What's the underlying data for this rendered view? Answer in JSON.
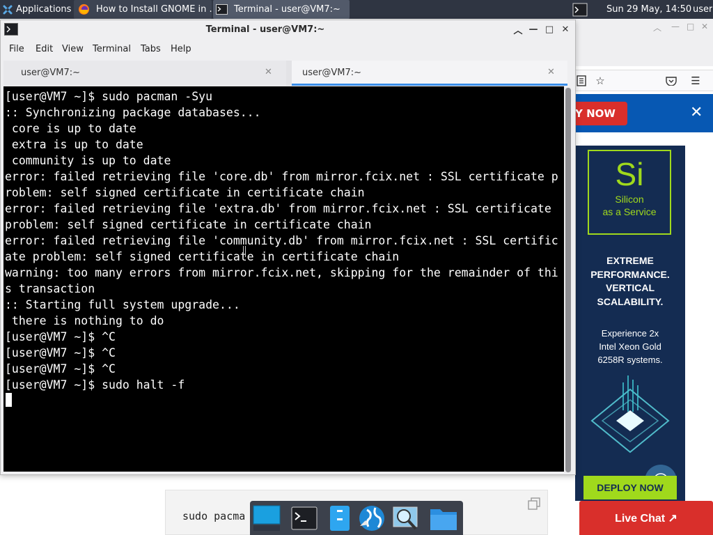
{
  "top_panel": {
    "applications_label": "Applications",
    "tasks": [
      {
        "label": "How to Install GNOME in ...",
        "icon": "firefox-icon"
      },
      {
        "label": "Terminal - user@VM7:~",
        "icon": "terminal-icon"
      }
    ],
    "clock": "Sun 29 May, 14:50",
    "user": "user"
  },
  "browser": {
    "banner_button": "Y NOW",
    "ad": {
      "logo_big": "Si",
      "logo_line1": "Silicon",
      "logo_line2": "as a Service",
      "headline": [
        "EXTREME",
        "PERFORMANCE.",
        "VERTICAL",
        "SCALABILITY."
      ],
      "copy": [
        "Experience 2x",
        "Intel Xeon Gold",
        "6258R systems."
      ],
      "cta": "DEPLOY NOW"
    },
    "live_chat": "Live Chat ↗",
    "code_snippet": "sudo pacma"
  },
  "terminal": {
    "title": "Terminal - user@VM7:~",
    "menu": [
      "File",
      "Edit",
      "View",
      "Terminal",
      "Tabs",
      "Help"
    ],
    "tabs": [
      {
        "label": "user@VM7:~",
        "active": false
      },
      {
        "label": "user@VM7:~",
        "active": true
      }
    ],
    "lines": [
      "[user@VM7 ~]$ sudo pacman -Syu",
      ":: Synchronizing package databases...",
      " core is up to date",
      " extra is up to date",
      " community is up to date",
      "error: failed retrieving file 'core.db' from mirror.fcix.net : SSL certificate p",
      "roblem: self signed certificate in certificate chain",
      "error: failed retrieving file 'extra.db' from mirror.fcix.net : SSL certificate",
      "problem: self signed certificate in certificate chain",
      "error: failed retrieving file 'community.db' from mirror.fcix.net : SSL certific",
      "ate problem: self signed certificate in certificate chain",
      "warning: too many errors from mirror.fcix.net, skipping for the remainder of thi",
      "s transaction",
      ":: Starting full system upgrade...",
      " there is nothing to do",
      "[user@VM7 ~]$ ^C",
      "[user@VM7 ~]$ ^C",
      "[user@VM7 ~]$ ^C",
      "[user@VM7 ~]$ sudo halt -f"
    ]
  },
  "colors": {
    "panel_bg": "#2f3542",
    "terminal_bg": "#000000",
    "terminal_fg": "#ffffff",
    "accent_tab": "#3b8ee8",
    "ad_bg": "#142c52",
    "ad_green": "#a0d91c",
    "cta_red": "#d92f2b",
    "banner_blue": "#0758b3"
  }
}
